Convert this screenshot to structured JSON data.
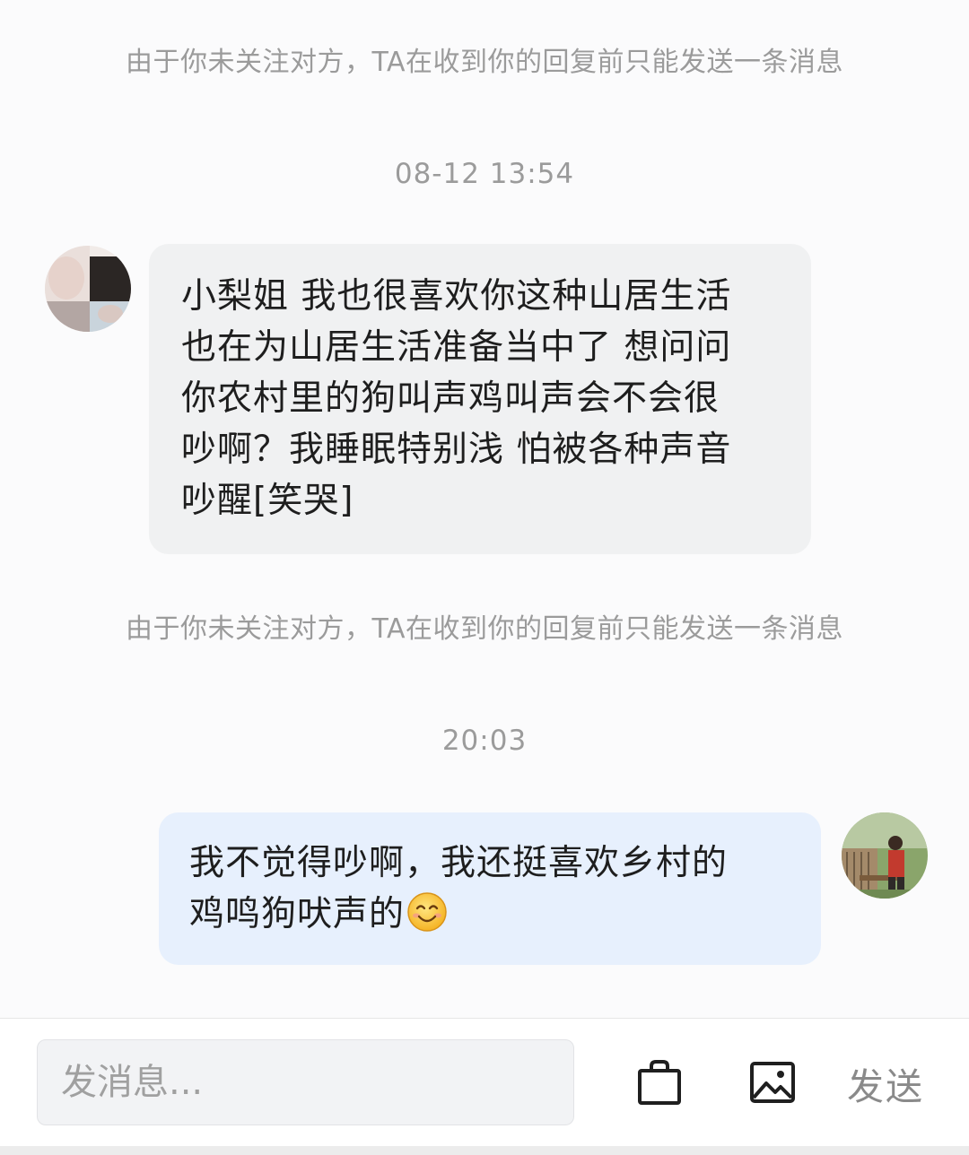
{
  "chat": {
    "notice_top": "由于你未关注对方，TA在收到你的回复前只能发送一条消息",
    "timestamp_1": "08-12 13:54",
    "incoming_message": "小梨姐 我也很喜欢你这种山居生活\n也在为山居生活准备当中了 想问问\n你农村里的狗叫声鸡叫声会不会很\n吵啊？我睡眠特别浅 怕被各种声音\n吵醒[笑哭]",
    "notice_middle": "由于你未关注对方，TA在收到你的回复前只能发送一条消息",
    "timestamp_2": "20:03",
    "outgoing_message": "我不觉得吵啊，我还挺喜欢乡村的\n鸡鸣狗吠声的",
    "outgoing_emoji": "smiling-face-emoji"
  },
  "input_bar": {
    "placeholder": "发消息...",
    "bag_icon": "shopping-bag-icon",
    "image_icon": "image-icon",
    "send_label": "发送"
  },
  "colors": {
    "incoming_bubble": "#f0f1f2",
    "outgoing_bubble": "#e7f0fd",
    "notice_text": "#9b9b9b"
  }
}
